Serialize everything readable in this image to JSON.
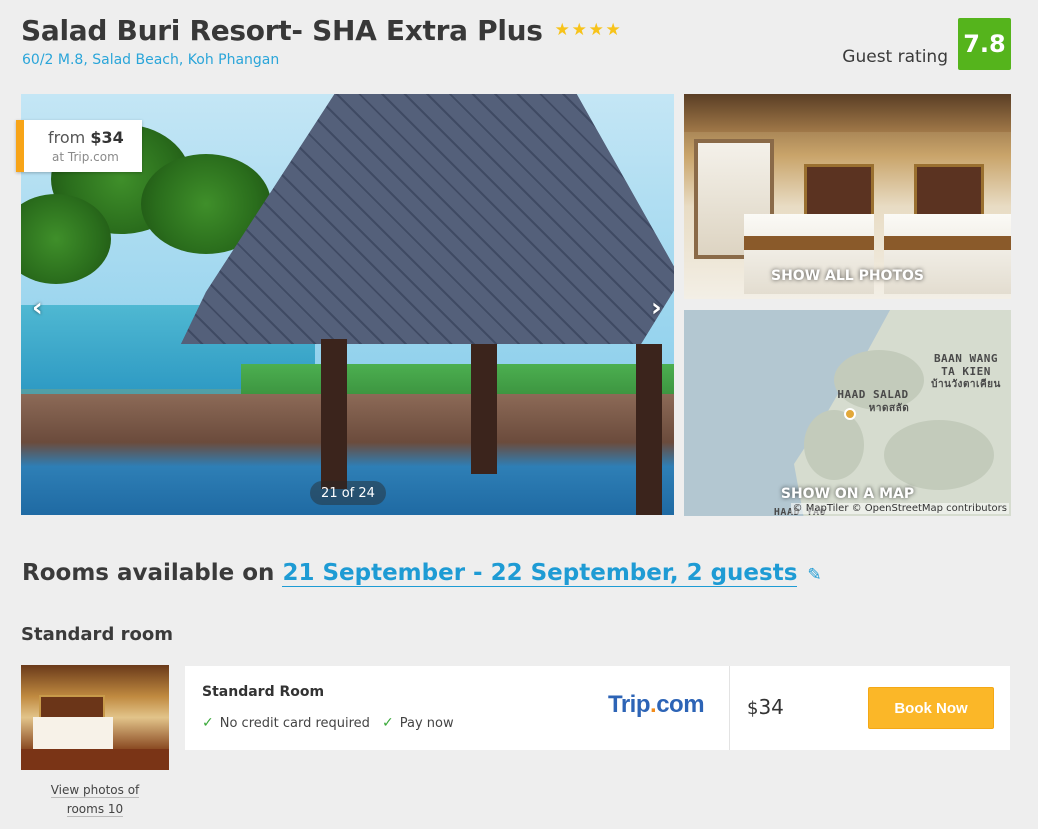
{
  "hotel": {
    "name": "Salad Buri Resort- SHA Extra Plus",
    "stars": 4,
    "star_glyph": "★",
    "address": "60/2 M.8, Salad Beach, Koh Phangan",
    "rating_label": "Guest rating",
    "rating_value": "7.8",
    "rating_color": "#55b41c"
  },
  "gallery": {
    "price_from_prefix": "from",
    "price_from_value": "$34",
    "price_site": "at Trip.com",
    "prev_arrow": "‹",
    "next_arrow": "›",
    "counter": "21 of 24",
    "show_all_photos": "SHOW ALL PHOTOS",
    "show_on_map": "SHOW ON A MAP",
    "map_attribution": "© MapTiler © OpenStreetMap contributors",
    "map_labels": {
      "baan_wang": "BAAN WANG\nTA KIEN",
      "baan_wang_thai": "บ้านวังตาเคียน",
      "haad_salad": "HAAD SALAD",
      "haad_salad_thai": "หาดสลัด",
      "haad_yao": "HAAD YAO"
    }
  },
  "rooms": {
    "heading_prefix": "Rooms available on",
    "dates_guests": "21 September - 22 September, 2 guests",
    "edit_icon": "✎",
    "room_type": "Standard room",
    "view_photos_line1": "View photos of",
    "view_photos_line2": "rooms 10"
  },
  "offer": {
    "room_name": "Standard Room",
    "features": [
      "No credit card required",
      "Pay now"
    ],
    "check_glyph": "✓",
    "provider_main": "Trip",
    "provider_dot": ".",
    "provider_suffix": "com",
    "currency": "$",
    "price": "34",
    "book_label": "Book Now",
    "accent_color": "#fbb728"
  }
}
